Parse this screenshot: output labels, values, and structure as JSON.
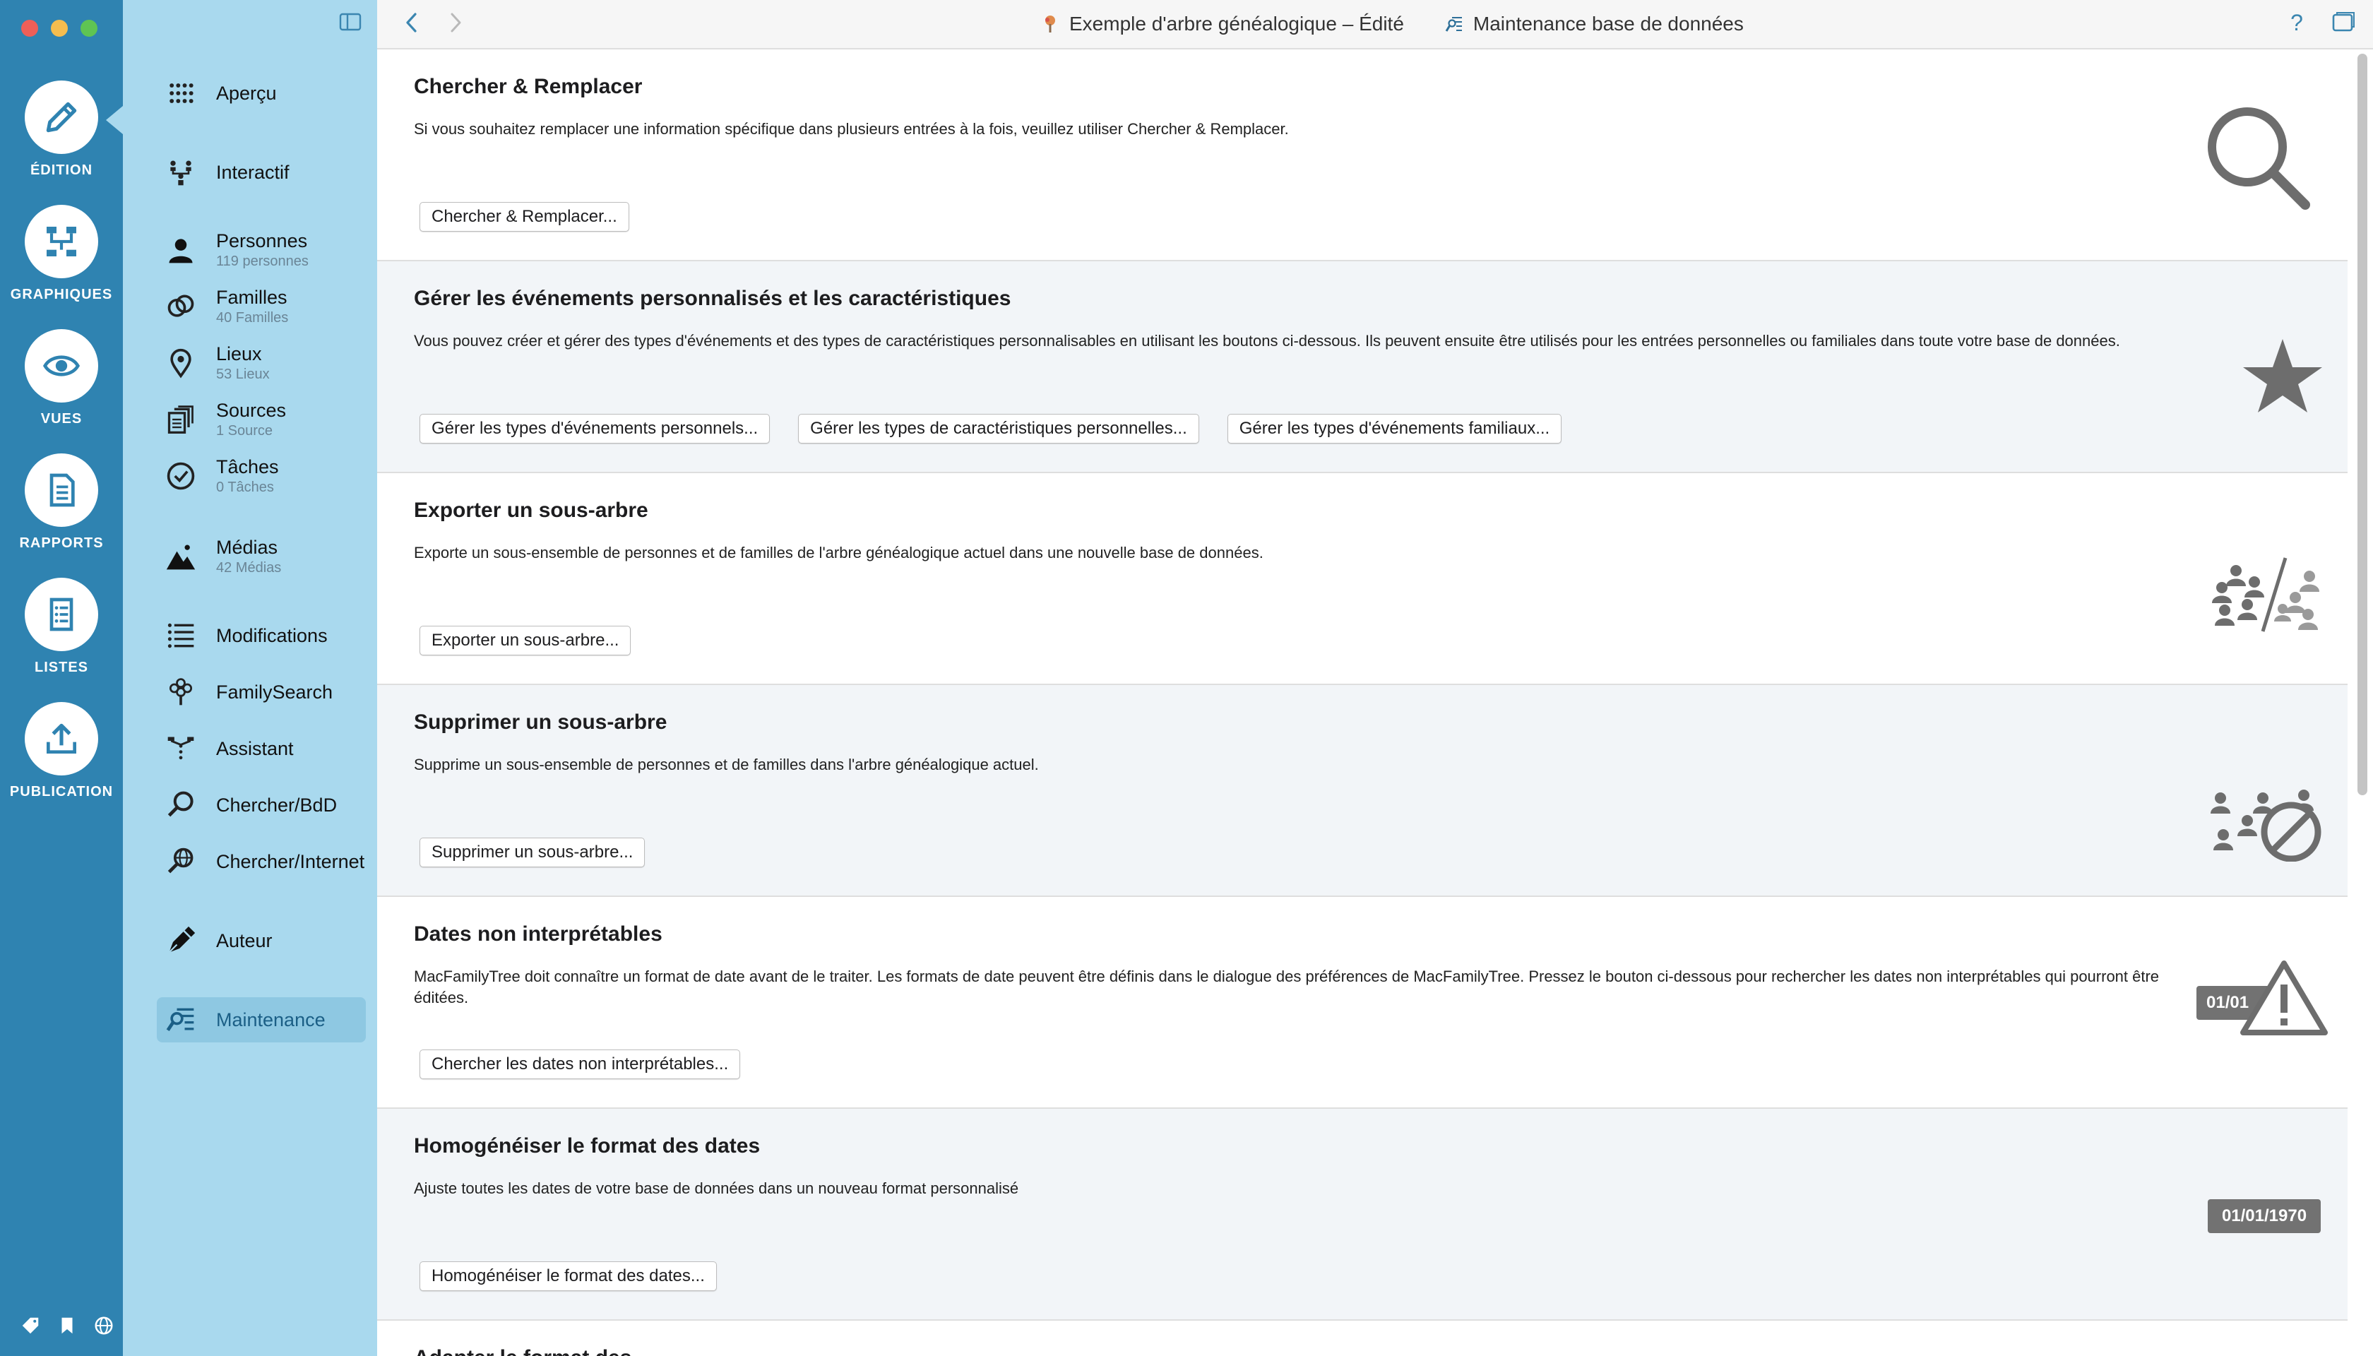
{
  "colors": {
    "rail": "#2f83b1",
    "sidebar": "#a9d9ee",
    "sidebar_active": "#8ec8e2",
    "icon_gray": "#6d6d6d",
    "close": "#ee5f58",
    "minimize": "#f5bd4f",
    "zoom": "#5fc453"
  },
  "rail": {
    "items": [
      {
        "label": "ÉDITION",
        "icon": "pencil-icon"
      },
      {
        "label": "GRAPHIQUES",
        "icon": "chart-icon"
      },
      {
        "label": "VUES",
        "icon": "eye-icon"
      },
      {
        "label": "RAPPORTS",
        "icon": "document-icon"
      },
      {
        "label": "LISTES",
        "icon": "list-icon"
      },
      {
        "label": "PUBLICATION",
        "icon": "upload-icon"
      }
    ]
  },
  "sidebar": {
    "items": [
      {
        "label": "Aperçu",
        "sub": "",
        "icon": "grid-icon"
      },
      {
        "label": "Interactif",
        "sub": "",
        "icon": "tree-people-icon"
      },
      {
        "label": "Personnes",
        "sub": "119 personnes",
        "icon": "person-icon"
      },
      {
        "label": "Familles",
        "sub": "40 Familles",
        "icon": "rings-icon"
      },
      {
        "label": "Lieux",
        "sub": "53 Lieux",
        "icon": "pin-icon"
      },
      {
        "label": "Sources",
        "sub": "1 Source",
        "icon": "sources-icon"
      },
      {
        "label": "Tâches",
        "sub": "0 Tâches",
        "icon": "check-circle-icon"
      },
      {
        "label": "Médias",
        "sub": "42 Médias",
        "icon": "mountain-icon"
      },
      {
        "label": "Modifications",
        "sub": "",
        "icon": "list-lines-icon"
      },
      {
        "label": "FamilySearch",
        "sub": "",
        "icon": "familysearch-tree-icon"
      },
      {
        "label": "Assistant",
        "sub": "",
        "icon": "assistant-tree-icon"
      },
      {
        "label": "Chercher/BdD",
        "sub": "",
        "icon": "search-icon"
      },
      {
        "label": "Chercher/Internet",
        "sub": "",
        "icon": "globe-search-icon"
      },
      {
        "label": "Auteur",
        "sub": "",
        "icon": "pen-nib-icon"
      },
      {
        "label": "Maintenance",
        "sub": "",
        "icon": "maintenance-icon"
      }
    ]
  },
  "toolbar": {
    "doc_title": "Exemple d'arbre généalogique – Édité",
    "page_title": "Maintenance base de données",
    "help": "?"
  },
  "sections": [
    {
      "title": "Chercher & Remplacer",
      "desc": "Si vous souhaitez remplacer une information spécifique dans plusieurs entrées à la fois, veuillez utiliser Chercher & Remplacer.",
      "buttons": [
        "Chercher & Remplacer..."
      ]
    },
    {
      "title": "Gérer les événements personnalisés et les caractéristiques",
      "desc": "Vous pouvez créer et gérer des types d'événements et des types de caractéristiques personnalisables en utilisant les boutons ci-dessous. Ils peuvent ensuite être utilisés pour les entrées personnelles ou familiales dans toute votre base de données.",
      "buttons": [
        "Gérer les types d'événements personnels...",
        "Gérer les types de caractéristiques personnelles...",
        "Gérer les types d'événements familiaux..."
      ]
    },
    {
      "title": "Exporter un sous-arbre",
      "desc": "Exporte un sous-ensemble de personnes et de familles de l'arbre généalogique actuel dans une nouvelle base de données.",
      "buttons": [
        "Exporter un sous-arbre..."
      ]
    },
    {
      "title": "Supprimer un sous-arbre",
      "desc": "Supprime un sous-ensemble de personnes et de familles dans l'arbre généalogique actuel.",
      "buttons": [
        "Supprimer un sous-arbre..."
      ]
    },
    {
      "title": "Dates non interprétables",
      "desc": "MacFamilyTree doit connaître un format de date avant de le traiter. Les formats de date peuvent être définis dans le dialogue des préférences de MacFamilyTree. Pressez le bouton ci-dessous pour rechercher les dates non interprétables qui pourront être éditées.",
      "buttons": [
        "Chercher les dates non interprétables..."
      ],
      "badge": "01/01"
    },
    {
      "title": "Homogénéiser le format des dates",
      "desc": "Ajuste toutes les dates de votre base de données dans un nouveau format personnalisé",
      "buttons": [
        "Homogénéiser le format des dates..."
      ],
      "badge": "01/01/1970"
    }
  ],
  "partial_section_title": "Adapter le format des"
}
